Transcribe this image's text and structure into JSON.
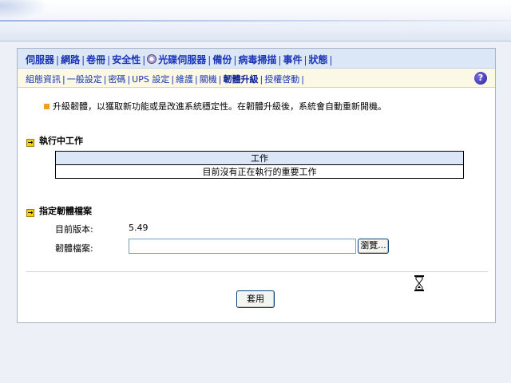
{
  "nav_primary": [
    {
      "label": "伺服器"
    },
    {
      "label": "網路"
    },
    {
      "label": "卷冊"
    },
    {
      "label": "安全性"
    },
    {
      "label": "光碟伺服器",
      "icon": "cd-icon"
    },
    {
      "label": "備份"
    },
    {
      "label": "病毒掃描"
    },
    {
      "label": "事件"
    },
    {
      "label": "狀態"
    }
  ],
  "nav_secondary": [
    {
      "label": "組態資訊"
    },
    {
      "label": "一般設定"
    },
    {
      "label": "密碼"
    },
    {
      "label": "UPS 設定"
    },
    {
      "label": "維護"
    },
    {
      "label": "關機"
    },
    {
      "label": "韌體升級",
      "active": true
    },
    {
      "label": "授權啓動"
    }
  ],
  "intro": "升級韌體，以獲取新功能或是改進系統穩定性。在韌體升級後，系統會自動重新開機。",
  "running_tasks": {
    "heading": "執行中工作",
    "column_header": "工作",
    "empty_message": "目前沒有正在執行的重要工作"
  },
  "firmware_file": {
    "heading": "指定韌體檔案",
    "current_version_label": "目前版本:",
    "current_version": "5.49",
    "file_label": "韌體檔案:",
    "file_value": "",
    "browse_label": "瀏覽..."
  },
  "apply_label": "套用",
  "help_label": "?",
  "colors": {
    "nav_primary_bg": "#dbe7f7",
    "nav_secondary_bg": "#fbf8e6",
    "link": "#1b34b6",
    "bullet": "#f0a020"
  }
}
